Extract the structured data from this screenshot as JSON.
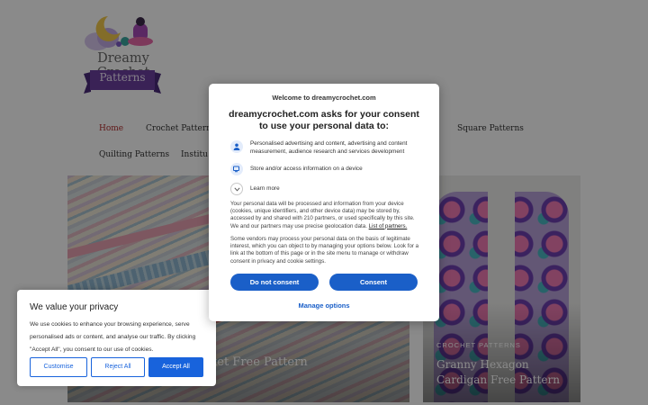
{
  "site": {
    "logo_title": "Dreamy Crochet",
    "logo_ribbon": "Patterns",
    "nav": [
      {
        "label": "Home",
        "active": true
      },
      {
        "label": "Crochet Patterns"
      },
      {
        "label": "Square Patterns"
      },
      {
        "label": "Quilting Patterns"
      },
      {
        "label": "Institu"
      }
    ],
    "cards": [
      {
        "title": "nket Free Pattern"
      },
      {
        "category": "CROCHET PATTERNS",
        "title": "Granny Hexagon Cardigan Free Pattern"
      }
    ]
  },
  "privacy_banner": {
    "title": "We value your privacy",
    "text": "We use cookies to enhance your browsing experience, serve personalised ads or content, and analyse our traffic. By clicking \"Accept All\", you consent to our use of cookies.",
    "buttons": {
      "customise": "Customise",
      "reject": "Reject All",
      "accept": "Accept All"
    }
  },
  "consent_dialog": {
    "welcome": "Welcome to dreamycrochet.com",
    "heading": "dreamycrochet.com asks for your consent to use your personal data to:",
    "purposes": [
      {
        "icon": "person-icon",
        "text": "Personalised advertising and content, advertising and content measurement, audience research and services development"
      },
      {
        "icon": "device-icon",
        "text": "Store and/or access information on a device"
      }
    ],
    "learn_more": "Learn more",
    "paragraph1": "Your personal data will be processed and information from your device (cookies, unique identifiers, and other device data) may be stored by, accessed by and shared with 210 partners, or used specifically by this site. We and our partners may use precise geolocation data.",
    "partners_link": "List of partners.",
    "paragraph2": "Some vendors may process your personal data on the basis of legitimate interest, which you can object to by managing your options below. Look for a link at the bottom of this page or in the site menu to manage or withdraw consent in privacy and cookie settings.",
    "do_not_consent": "Do not consent",
    "consent": "Consent",
    "manage_options": "Manage options"
  },
  "colors": {
    "accent": "#1a5fc8",
    "banner_accent": "#1863dc",
    "nav_active": "#b22d2d"
  }
}
